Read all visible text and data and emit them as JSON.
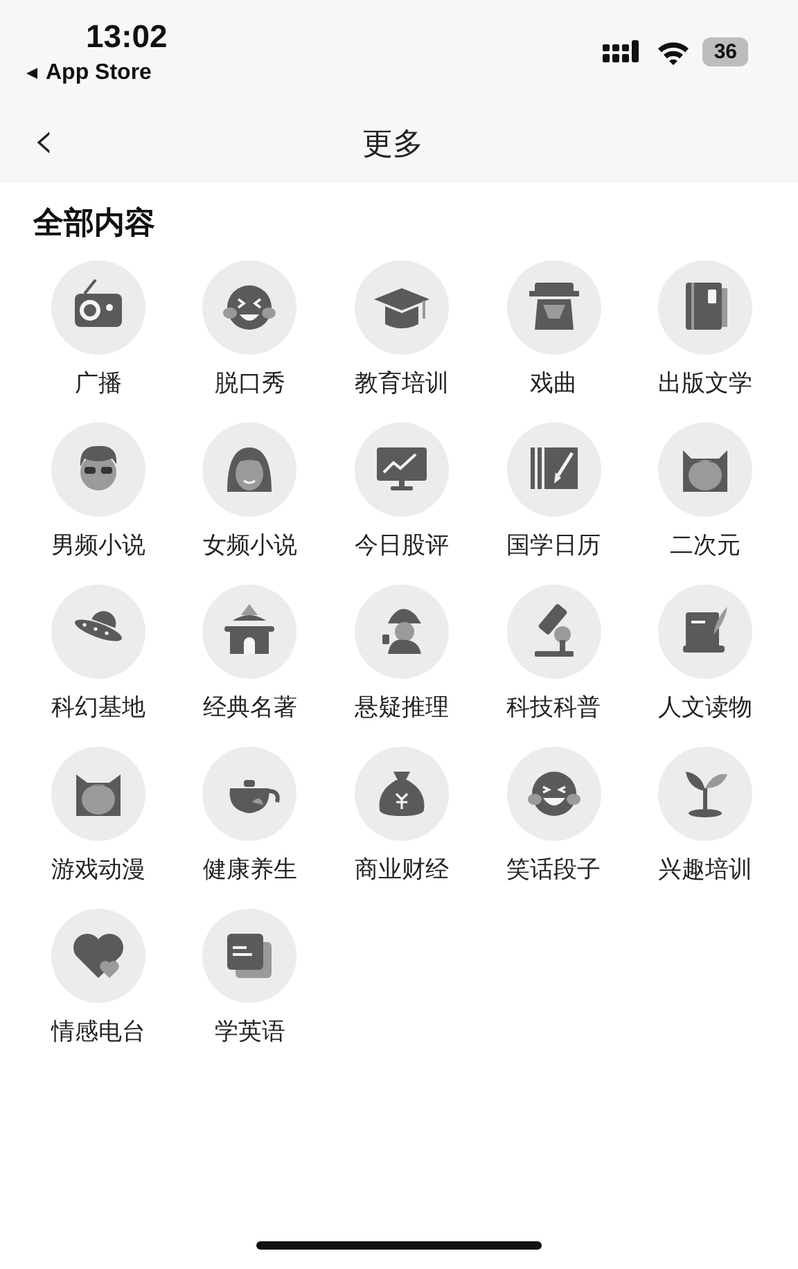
{
  "status_bar": {
    "time": "13:02",
    "back_app": "App Store",
    "battery": "36"
  },
  "nav": {
    "back": "‹",
    "title": "更多"
  },
  "section": {
    "title": "全部内容",
    "items": [
      {
        "label": "广播"
      },
      {
        "label": "脱口秀"
      },
      {
        "label": "教育培训"
      },
      {
        "label": "戏曲"
      },
      {
        "label": "出版文学"
      },
      {
        "label": "男频小说"
      },
      {
        "label": "女频小说"
      },
      {
        "label": "今日股评"
      },
      {
        "label": "国学日历"
      },
      {
        "label": "二次元"
      },
      {
        "label": "科幻基地"
      },
      {
        "label": "经典名著"
      },
      {
        "label": "悬疑推理"
      },
      {
        "label": "科技科普"
      },
      {
        "label": "人文读物"
      },
      {
        "label": "游戏动漫"
      },
      {
        "label": "健康养生"
      },
      {
        "label": "商业财经"
      },
      {
        "label": "笑话段子"
      },
      {
        "label": "兴趣培训"
      },
      {
        "label": "情感电台"
      },
      {
        "label": "学英语"
      }
    ]
  }
}
